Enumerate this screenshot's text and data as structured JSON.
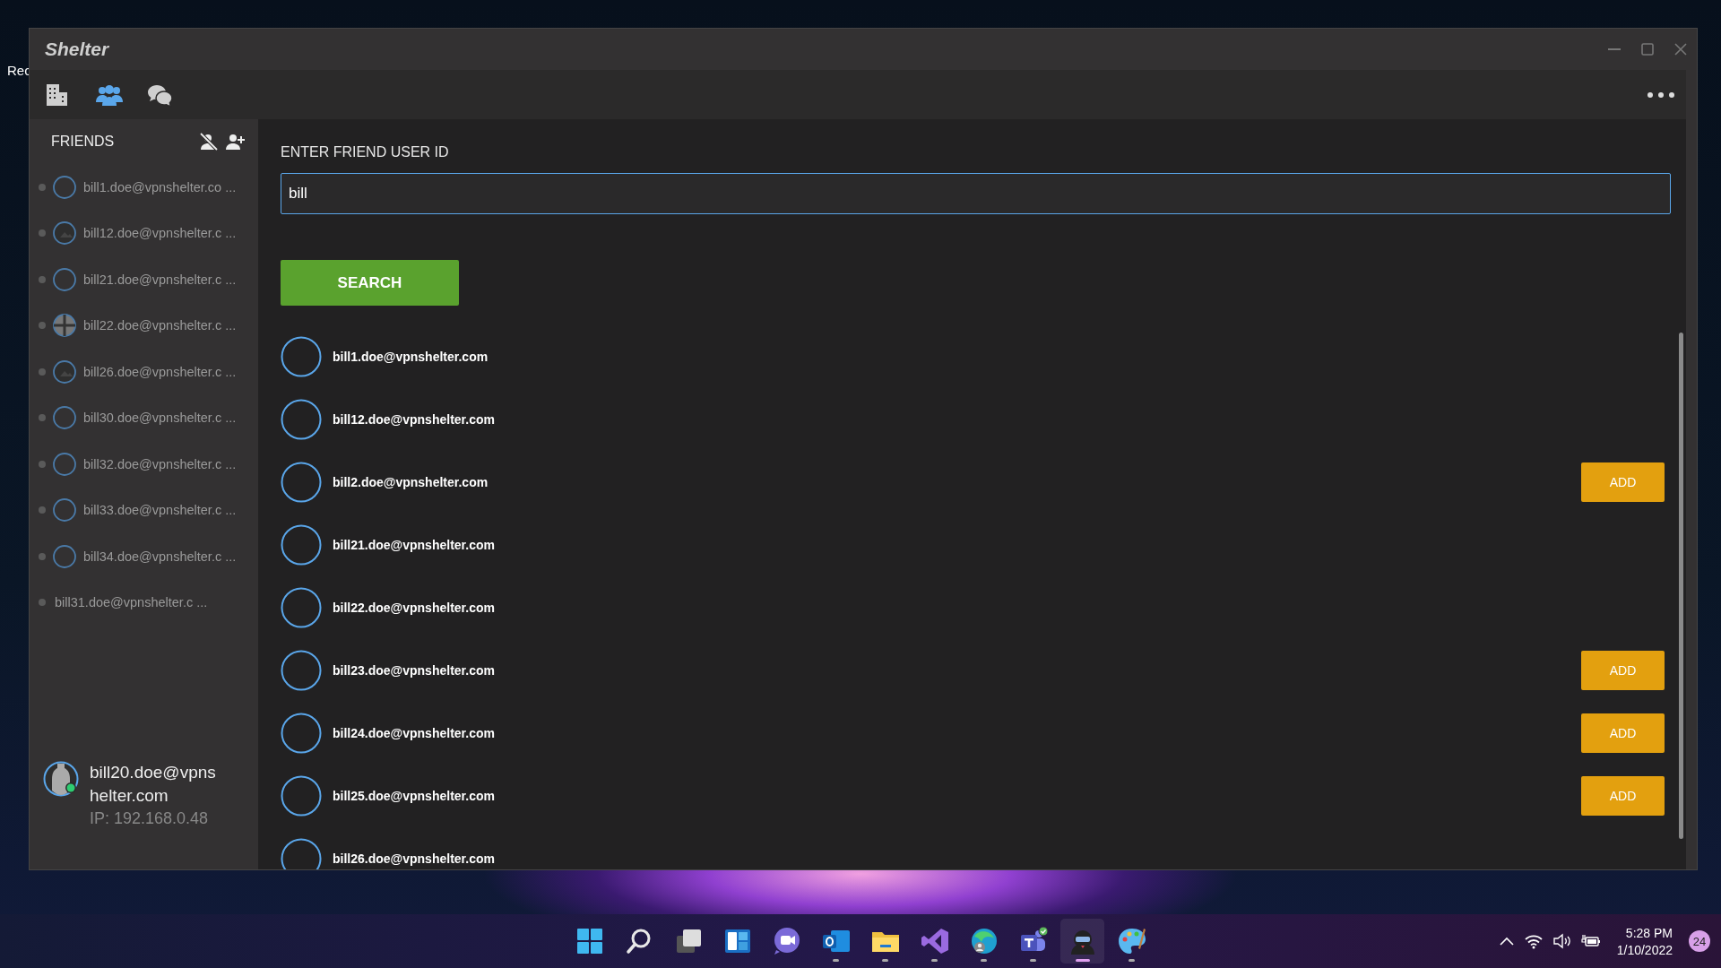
{
  "desktop": {
    "icon_label": "Rec"
  },
  "window": {
    "title": "Shelter"
  },
  "toolbar": {
    "tabs": [
      {
        "kind": "building",
        "selected": false
      },
      {
        "kind": "people",
        "selected": true
      },
      {
        "kind": "chat",
        "selected": false
      }
    ]
  },
  "sidebar": {
    "title": "FRIENDS",
    "friends": [
      {
        "name": "bill1.doe@vpnshelter.co ...",
        "kind": "ring"
      },
      {
        "name": "bill12.doe@vpnshelter.c ...",
        "kind": "image"
      },
      {
        "name": "bill21.doe@vpnshelter.c ...",
        "kind": "ring"
      },
      {
        "name": "bill22.doe@vpnshelter.c ...",
        "kind": "cross"
      },
      {
        "name": "bill26.doe@vpnshelter.c ...",
        "kind": "image"
      },
      {
        "name": "bill30.doe@vpnshelter.c ...",
        "kind": "ring"
      },
      {
        "name": "bill32.doe@vpnshelter.c ...",
        "kind": "ring"
      },
      {
        "name": "bill33.doe@vpnshelter.c ...",
        "kind": "ring"
      },
      {
        "name": "bill34.doe@vpnshelter.c ...",
        "kind": "ring"
      },
      {
        "name": "bill31.doe@vpnshelter.c ...",
        "kind": "plain"
      }
    ],
    "profile": {
      "name": "bill20.doe@vpnshelter.com",
      "ip": "IP: 192.168.0.48",
      "online": true
    }
  },
  "search": {
    "label": "ENTER FRIEND USER ID",
    "value": "bill",
    "button": "SEARCH"
  },
  "results": [
    {
      "name": "bill1.doe@vpnshelter.com"
    },
    {
      "name": "bill12.doe@vpnshelter.com"
    },
    {
      "name": "bill2.doe@vpnshelter.com",
      "action": "ADD"
    },
    {
      "name": "bill21.doe@vpnshelter.com"
    },
    {
      "name": "bill22.doe@vpnshelter.com"
    },
    {
      "name": "bill23.doe@vpnshelter.com",
      "action": "ADD"
    },
    {
      "name": "bill24.doe@vpnshelter.com",
      "action": "ADD"
    },
    {
      "name": "bill25.doe@vpnshelter.com",
      "action": "ADD"
    },
    {
      "name": "bill26.doe@vpnshelter.com"
    }
  ],
  "taskbar": {
    "apps": [
      {
        "kind": "start",
        "running": false,
        "selected": false
      },
      {
        "kind": "search",
        "running": false,
        "selected": false
      },
      {
        "kind": "taskview",
        "running": false,
        "selected": false
      },
      {
        "kind": "widgets",
        "running": false,
        "selected": false
      },
      {
        "kind": "meet",
        "running": false,
        "selected": false
      },
      {
        "kind": "mail",
        "running": true,
        "selected": false
      },
      {
        "kind": "folder",
        "running": true,
        "selected": false
      },
      {
        "kind": "ide",
        "running": true,
        "selected": false
      },
      {
        "kind": "browser",
        "running": true,
        "selected": false
      },
      {
        "kind": "teams",
        "running": true,
        "selected": false
      },
      {
        "kind": "shelter",
        "running": true,
        "selected": true
      },
      {
        "kind": "paint",
        "running": true,
        "selected": false
      }
    ],
    "tray": {
      "time": "5:28 PM",
      "date": "1/10/2022",
      "notifications": "24"
    }
  }
}
